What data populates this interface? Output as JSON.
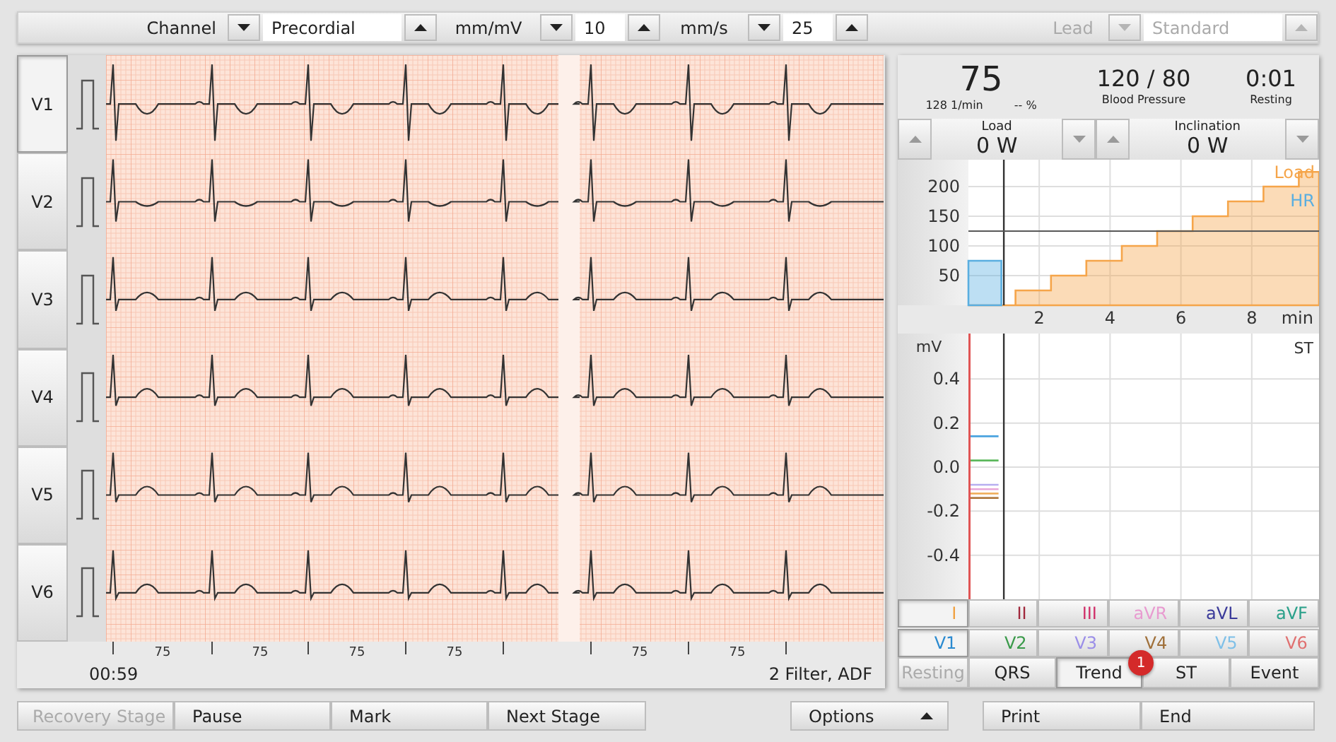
{
  "toolbar": [
    {
      "label": "Channel",
      "value": "Precordial",
      "disabled": false
    },
    {
      "label": "mm/mV",
      "value": "10",
      "disabled": false
    },
    {
      "label": "mm/s",
      "value": "25",
      "disabled": false
    },
    {
      "label": "Lead",
      "value": "Standard",
      "disabled": true
    }
  ],
  "leads": [
    {
      "label": "V1",
      "selected": true
    },
    {
      "label": "V2",
      "selected": false
    },
    {
      "label": "V3",
      "selected": false
    },
    {
      "label": "V4",
      "selected": false
    },
    {
      "label": "V5",
      "selected": false
    },
    {
      "label": "V6",
      "selected": false
    }
  ],
  "ecg": {
    "beat_rates": [
      "75",
      "75",
      "75",
      "75",
      "75",
      "75"
    ],
    "elapsed": "00:59",
    "filter": "2 Filter, ADF"
  },
  "vitals": {
    "heart_rate": "75",
    "heart_rate_detail": "128 1/min",
    "percent": "-- %",
    "blood_pressure": "120 / 80",
    "blood_pressure_label": "Blood Pressure",
    "time": "0:01",
    "phase": "Resting"
  },
  "adjusters": [
    {
      "label": "Load",
      "value": "0 W"
    },
    {
      "label": "Inclination",
      "value": "0 W"
    }
  ],
  "trend": {
    "chart_data": {
      "type": "area",
      "grid": true,
      "xlabel": "min",
      "x": [
        0,
        0.93,
        1.33,
        1.33,
        2.33,
        2.33,
        3.33,
        3.33,
        4.33,
        4.33,
        5.33,
        5.33,
        6.33,
        6.33,
        7.33,
        7.33,
        8.33,
        8.33,
        9.33,
        9.33,
        9.9
      ],
      "series": [
        {
          "name": "Load",
          "color": "#f5a54a",
          "values": [
            0,
            0,
            0,
            25,
            25,
            50,
            50,
            75,
            75,
            100,
            100,
            125,
            125,
            150,
            150,
            175,
            175,
            200,
            200,
            225,
            225
          ]
        },
        {
          "name": "HR",
          "color": "#5aaee0",
          "values": [
            75,
            75,
            null,
            null,
            null,
            null,
            null,
            null,
            null,
            null,
            null,
            null,
            null,
            null,
            null,
            null,
            null,
            null,
            null,
            null,
            null
          ]
        }
      ],
      "xlim": [
        0,
        9.9
      ],
      "ylim": [
        0,
        243
      ],
      "xticks": [
        2,
        4,
        6,
        8
      ],
      "yticks": [
        50,
        100,
        150,
        200
      ],
      "ref_lines": [
        {
          "axis": "x",
          "value": 1
        },
        {
          "axis": "y",
          "value": 125
        }
      ]
    }
  },
  "st": {
    "chart_data": {
      "type": "line",
      "grid": true,
      "title": "ST",
      "ylabel": "mV",
      "x": [
        0,
        0.85
      ],
      "series": [
        {
          "color": "#4aa3df",
          "values": [
            0.14,
            0.14
          ]
        },
        {
          "color": "#5cb85c",
          "values": [
            0.03,
            0.03
          ]
        },
        {
          "color": "#b7aef0",
          "values": [
            -0.08,
            -0.08
          ]
        },
        {
          "color": "#e8a6d8",
          "values": [
            -0.1,
            -0.1
          ]
        },
        {
          "color": "#f0b060",
          "values": [
            -0.12,
            -0.12
          ]
        },
        {
          "color": "#b07a40",
          "values": [
            -0.14,
            -0.14
          ]
        }
      ],
      "xlim": [
        0,
        9.9
      ],
      "ylim": [
        -0.6,
        0.6
      ],
      "yticks": [
        0.4,
        0.2,
        {
          "value": 0,
          "label": "0.0"
        },
        -0.2,
        -0.4
      ],
      "ref_lines": [
        {
          "axis": "x",
          "value": 1
        }
      ]
    }
  },
  "st_leads": [
    {
      "label": "I",
      "color": "#f0a040",
      "selected": true
    },
    {
      "label": "II",
      "color": "#a0283c",
      "selected": false
    },
    {
      "label": "III",
      "color": "#d0306a",
      "selected": false
    },
    {
      "label": "aVR",
      "color": "#e89bd0",
      "selected": false
    },
    {
      "label": "aVL",
      "color": "#3a3a9a",
      "selected": false
    },
    {
      "label": "aVF",
      "color": "#2aa08a",
      "selected": false
    },
    {
      "label": "V1",
      "color": "#2a8ad0",
      "selected": true
    },
    {
      "label": "V2",
      "color": "#3a9a4a",
      "selected": false
    },
    {
      "label": "V3",
      "color": "#9b8fe8",
      "selected": false
    },
    {
      "label": "V4",
      "color": "#a0703a",
      "selected": false
    },
    {
      "label": "V5",
      "color": "#7fc0e8",
      "selected": false
    },
    {
      "label": "V6",
      "color": "#e07070",
      "selected": false
    }
  ],
  "tabs": [
    {
      "label": "Resting",
      "selected": false,
      "disabled": true
    },
    {
      "label": "QRS",
      "selected": false,
      "disabled": false
    },
    {
      "label": "Trend",
      "selected": true,
      "disabled": false,
      "badge": "1"
    },
    {
      "label": "ST",
      "selected": false,
      "disabled": false
    },
    {
      "label": "Event",
      "selected": false,
      "disabled": false
    }
  ],
  "buttons": [
    {
      "label": "Recovery Stage",
      "disabled": true,
      "menu": false
    },
    {
      "label": "Pause",
      "disabled": false,
      "menu": false
    },
    {
      "label": "Mark",
      "disabled": false,
      "menu": false
    },
    {
      "label": "Next Stage",
      "disabled": false,
      "menu": false
    },
    {
      "label": "Options",
      "disabled": false,
      "menu": true
    },
    {
      "label": "Print",
      "disabled": false,
      "menu": false
    },
    {
      "label": "End",
      "disabled": false,
      "menu": false
    }
  ]
}
